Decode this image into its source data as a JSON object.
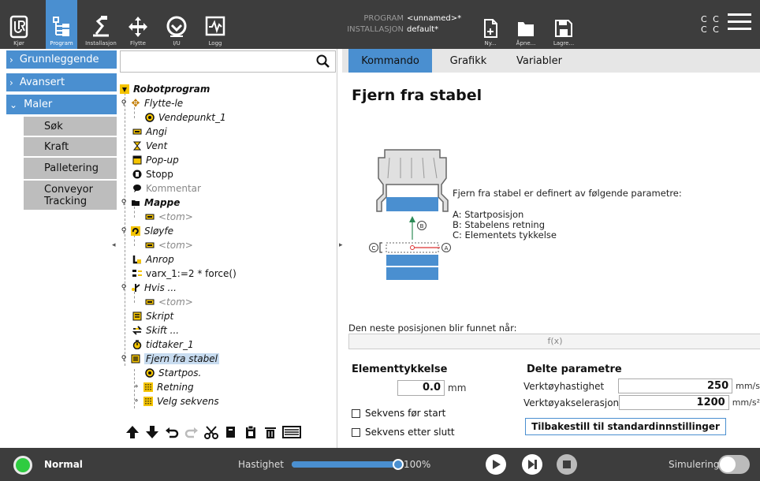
{
  "header": {
    "nav": [
      {
        "label": "Kjør",
        "icon": "ur-logo-icon"
      },
      {
        "label": "Program",
        "icon": "program-tree-icon"
      },
      {
        "label": "Installasjon",
        "icon": "installation-icon"
      },
      {
        "label": "Flytte",
        "icon": "move-icon"
      },
      {
        "label": "I/U",
        "icon": "io-icon"
      },
      {
        "label": "Logg",
        "icon": "log-icon"
      }
    ],
    "program_key": "PROGRAM",
    "program_value": "<unnamed>*",
    "installation_key": "INSTALLASJON",
    "installation_value": "default*",
    "file_buttons": [
      {
        "label": "Ny...",
        "icon": "new-file-icon"
      },
      {
        "label": "Åpne...",
        "icon": "open-folder-icon"
      },
      {
        "label": "Lagre...",
        "icon": "save-icon"
      }
    ],
    "cc_line1": "C C",
    "cc_line2": "C C"
  },
  "sidebar": {
    "items": [
      {
        "label": "Grunnleggende",
        "chevron": "›"
      },
      {
        "label": "Avansert",
        "chevron": "›"
      },
      {
        "label": "Maler",
        "chevron": "⌄"
      }
    ],
    "sub_items": [
      "Søk",
      "Kraft",
      "Palletering",
      "Conveyor Tracking"
    ]
  },
  "tree": {
    "root": "Robotprogram",
    "nodes": [
      {
        "label": "Flytte-le",
        "icon": "move-icon"
      },
      {
        "label": "Vendepunkt_1",
        "icon": "waypoint-icon"
      },
      {
        "label": "Angi",
        "icon": "set-icon"
      },
      {
        "label": "Vent",
        "icon": "wait-icon"
      },
      {
        "label": "Pop-up",
        "icon": "popup-icon"
      },
      {
        "label": "Stopp",
        "icon": "stop-icon"
      },
      {
        "label": "Kommentar",
        "icon": "comment-icon"
      },
      {
        "label": "Mappe",
        "icon": "folder-icon"
      },
      {
        "label": "<tom>",
        "icon": "empty-icon"
      },
      {
        "label": "Sløyfe",
        "icon": "loop-icon"
      },
      {
        "label": "<tom>",
        "icon": "empty-icon"
      },
      {
        "label": "Anrop",
        "icon": "call-icon"
      },
      {
        "label": "varx_1:=2 * force()",
        "icon": "assignment-icon"
      },
      {
        "label": "Hvis ...",
        "icon": "if-icon"
      },
      {
        "label": "<tom>",
        "icon": "empty-icon"
      },
      {
        "label": "Skript",
        "icon": "script-icon"
      },
      {
        "label": "Skift ...",
        "icon": "switch-icon"
      },
      {
        "label": "tidtaker_1",
        "icon": "timer-icon"
      },
      {
        "label": "Fjern fra stabel",
        "icon": "destack-icon"
      },
      {
        "label": "Startpos.",
        "icon": "waypoint-icon"
      },
      {
        "label": "Retning",
        "icon": "direction-icon"
      },
      {
        "label": "Velg sekvens",
        "icon": "sequence-icon"
      }
    ]
  },
  "tabs": [
    "Kommando",
    "Grafikk",
    "Variabler"
  ],
  "main": {
    "title": "Fjern fra stabel",
    "desc_line1": "Fjern fra stabel er definert av følgende parametre:",
    "desc_a": "A: Startposisjon",
    "desc_b": "B: Stabelens retning",
    "desc_c": "C: Elementets tykkelse",
    "diagram_a": "A",
    "diagram_b": "B",
    "diagram_c": "C",
    "next_pos_label": "Den neste posisjonen blir funnet når:",
    "fx_placeholder": "f(x)",
    "thickness_label": "Elementtykkelse",
    "thickness_value": "0.0",
    "thickness_unit": "mm",
    "seq_before": "Sekvens før start",
    "seq_after": "Sekvens etter slutt",
    "shared_label": "Delte parametre",
    "tool_speed_label": "Verktøyhastighet",
    "tool_speed_value": "250",
    "tool_speed_unit": "mm/s",
    "tool_accel_label": "Verktøyakselerasjon",
    "tool_accel_value": "1200",
    "tool_accel_unit": "mm/s²",
    "reset_button": "Tilbakestill til standardinnstillinger"
  },
  "footer": {
    "status": "Normal",
    "speed_label": "Hastighet",
    "speed_value": "100%",
    "speed_fraction": 1.0,
    "sim_label": "Simulering"
  },
  "colors": {
    "accent": "#4a8fd0",
    "header_bg": "#3d3d3d",
    "status_ok": "#2ecc40"
  }
}
